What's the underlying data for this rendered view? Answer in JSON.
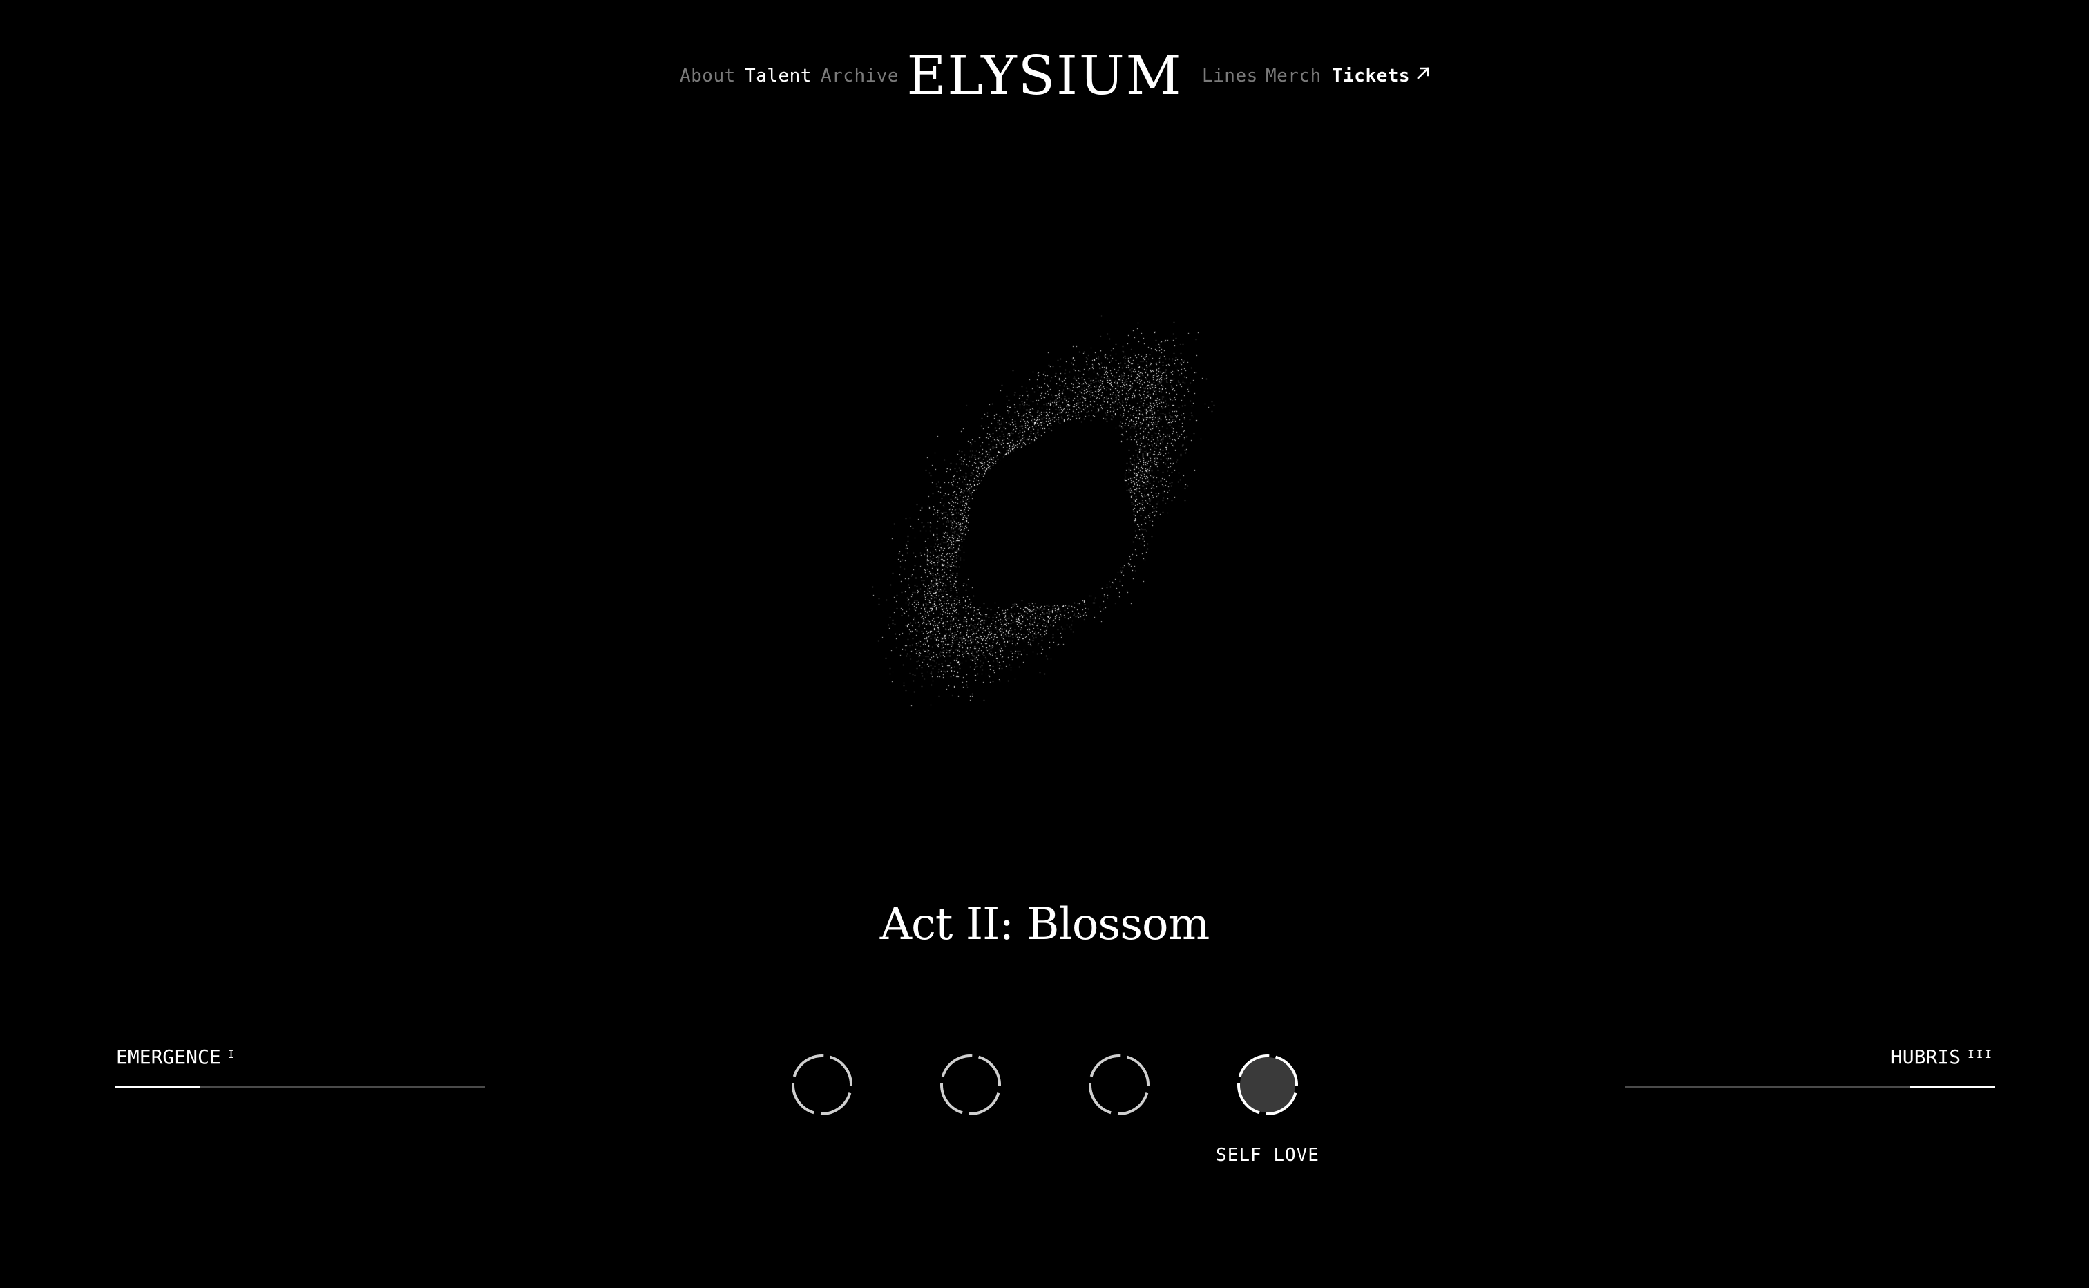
{
  "header": {
    "logo": "ELYSIUM",
    "nav_left": [
      {
        "label": "About",
        "state": "dim"
      },
      {
        "label": "Talent",
        "state": "active"
      },
      {
        "label": "Archive",
        "state": "dim"
      }
    ],
    "nav_right": [
      {
        "label": "Lines",
        "state": "dim"
      },
      {
        "label": "Merch",
        "state": "dim"
      },
      {
        "label": "Tickets",
        "state": "active",
        "icon": "arrow-up-right-icon"
      }
    ]
  },
  "visual": {
    "type": "particle-ring",
    "icon": "particle-ring-visual"
  },
  "main": {
    "act_title": "Act II: Blossom"
  },
  "act_nav": {
    "prev": {
      "label": "EMERGENCE",
      "numeral": "I",
      "progress": 0.23
    },
    "next": {
      "label": "HUBRIS",
      "numeral": "III",
      "progress": 0.23
    }
  },
  "selectors": {
    "items": [
      {
        "state": "inactive"
      },
      {
        "state": "inactive"
      },
      {
        "state": "inactive"
      },
      {
        "state": "active"
      }
    ],
    "active_label": "SELF LOVE"
  },
  "colors": {
    "background": "#000000",
    "text": "#ffffff",
    "dim_text": "#7a7a7a",
    "track": "#4a4a4a",
    "active_fill": "#3a3a3a"
  }
}
